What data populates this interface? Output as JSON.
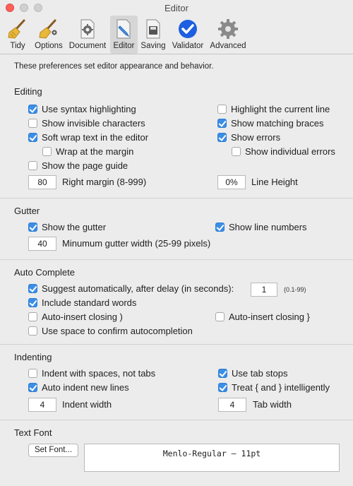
{
  "window": {
    "title": "Editor"
  },
  "toolbar": {
    "items": [
      {
        "label": "Tidy",
        "icon": "broom-icon"
      },
      {
        "label": "Options",
        "icon": "broom-sparkle-icon"
      },
      {
        "label": "Document",
        "icon": "document-gear-icon"
      },
      {
        "label": "Editor",
        "icon": "pencil-document-icon",
        "active": true
      },
      {
        "label": "Saving",
        "icon": "disk-document-icon"
      },
      {
        "label": "Validator",
        "icon": "checkmark-circle-icon"
      },
      {
        "label": "Advanced",
        "icon": "gear-icon"
      }
    ]
  },
  "intro": "These preferences set editor appearance and behavior.",
  "editing": {
    "title": "Editing",
    "syntax": "Use syntax highlighting",
    "invisible": "Show invisible characters",
    "soft_wrap": "Soft wrap text in the editor",
    "wrap_margin": "Wrap at the margin",
    "page_guide": "Show the page guide",
    "highlight_line": "Highlight the current line",
    "matching_braces": "Show matching braces",
    "show_errors": "Show errors",
    "individual_errors": "Show individual errors",
    "right_margin_value": "80",
    "right_margin_label": "Right margin (8-999)",
    "line_height_value": "0%",
    "line_height_label": "Line Height"
  },
  "gutter": {
    "title": "Gutter",
    "show_gutter": "Show the gutter",
    "line_numbers": "Show line numbers",
    "width_value": "40",
    "width_label": "Minumum gutter width (25-99 pixels)"
  },
  "autocomplete": {
    "title": "Auto Complete",
    "suggest": "Suggest automatically, after delay (in seconds):",
    "delay_value": "1",
    "delay_hint": "(0.1-99)",
    "standard_words": "Include standard words",
    "insert_paren": "Auto-insert closing )",
    "insert_brace": "Auto-insert closing }",
    "space_confirm": "Use space to confirm autocompletion"
  },
  "indenting": {
    "title": "Indenting",
    "spaces": "Indent with spaces, not tabs",
    "auto_indent": "Auto indent new lines",
    "indent_value": "4",
    "indent_label": "Indent width",
    "tab_stops": "Use tab stops",
    "treat_braces": "Treat { and } intelligently",
    "tab_value": "4",
    "tab_label": "Tab width"
  },
  "font": {
    "title": "Text Font",
    "button": "Set Font...",
    "current": "Menlo-Regular – 11pt"
  },
  "colors": {
    "accent": "#3a8ee6"
  }
}
